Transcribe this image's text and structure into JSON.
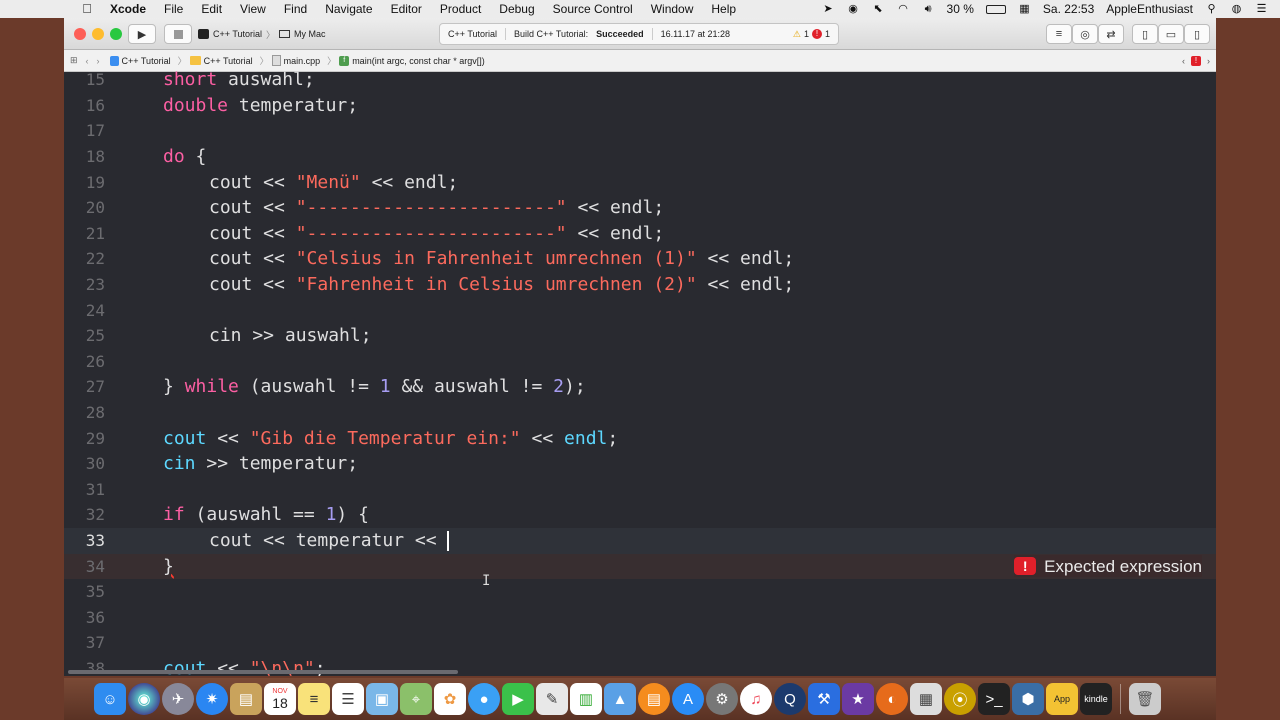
{
  "menubar": {
    "apple": "",
    "app_name": "Xcode",
    "items": [
      "File",
      "Edit",
      "View",
      "Find",
      "Navigate",
      "Editor",
      "Product",
      "Debug",
      "Source Control",
      "Window",
      "Help"
    ],
    "battery": "30 %",
    "clock": "Sa. 22:53",
    "user": "AppleEnthusiast"
  },
  "toolbar": {
    "scheme_project": "C++ Tutorial",
    "scheme_destination": "My Mac",
    "activity_project": "C++ Tutorial",
    "activity_status_prefix": "Build C++ Tutorial:",
    "activity_status": "Succeeded",
    "activity_time": "16.11.17 at 21:28",
    "warning_count": "1",
    "error_count": "1"
  },
  "jumpbar": {
    "crumbs": [
      "C++ Tutorial",
      "C++ Tutorial",
      "main.cpp",
      "main(int argc, const char * argv[])"
    ]
  },
  "editor": {
    "error_message": "Expected expression",
    "lines": [
      {
        "n": "15"
      },
      {
        "n": "16"
      },
      {
        "n": "17"
      },
      {
        "n": "18"
      },
      {
        "n": "19"
      },
      {
        "n": "20"
      },
      {
        "n": "21"
      },
      {
        "n": "22"
      },
      {
        "n": "23"
      },
      {
        "n": "24"
      },
      {
        "n": "25"
      },
      {
        "n": "26"
      },
      {
        "n": "27"
      },
      {
        "n": "28"
      },
      {
        "n": "29"
      },
      {
        "n": "30"
      },
      {
        "n": "31"
      },
      {
        "n": "32"
      },
      {
        "n": "33"
      },
      {
        "n": "34"
      },
      {
        "n": "35"
      },
      {
        "n": "36"
      },
      {
        "n": "37"
      },
      {
        "n": "38"
      }
    ],
    "tokens": {
      "l15_kw": "short",
      "l15_rest": " auswahl;",
      "l16_kw": "double",
      "l16_rest": " temperatur;",
      "l18_kw": "do",
      "l18_rest": " {",
      "l19_a": "cout << ",
      "l19_s": "\"Menü\"",
      "l19_b": " << endl;",
      "l20_a": "cout << ",
      "l20_s": "\"-----------------------\"",
      "l20_b": " << endl;",
      "l21_a": "cout << ",
      "l21_s": "\"-----------------------\"",
      "l21_b": " << endl;",
      "l22_a": "cout << ",
      "l22_s": "\"Celsius in Fahrenheit umrechnen (1)\"",
      "l22_b": " << endl;",
      "l23_a": "cout << ",
      "l23_s": "\"Fahrenheit in Celsius umrechnen (2)\"",
      "l23_b": " << endl;",
      "l25": "cin >> auswahl;",
      "l27_a": "} ",
      "l27_kw": "while",
      "l27_b": " (auswahl != ",
      "l27_n1": "1",
      "l27_c": " && auswahl != ",
      "l27_n2": "2",
      "l27_d": ");",
      "l29_a": "cout",
      "l29_b": " << ",
      "l29_s": "\"Gib die Temperatur ein:\"",
      "l29_c": " << ",
      "l29_d": "endl",
      "l29_e": ";",
      "l30_a": "cin",
      "l30_b": " >> temperatur;",
      "l32_kw": "if",
      "l32_a": " (auswahl == ",
      "l32_n": "1",
      "l32_b": ") {",
      "l33": "cout << temperatur << ",
      "l34": "}",
      "l38_a": "cout",
      "l38_b": " << ",
      "l38_s": "\"\\n\\n\"",
      "l38_c": ";"
    }
  },
  "dock": {
    "calendar_month": "NOV",
    "calendar_day": "18",
    "kindle_label": "kindle",
    "app_label": "App"
  }
}
